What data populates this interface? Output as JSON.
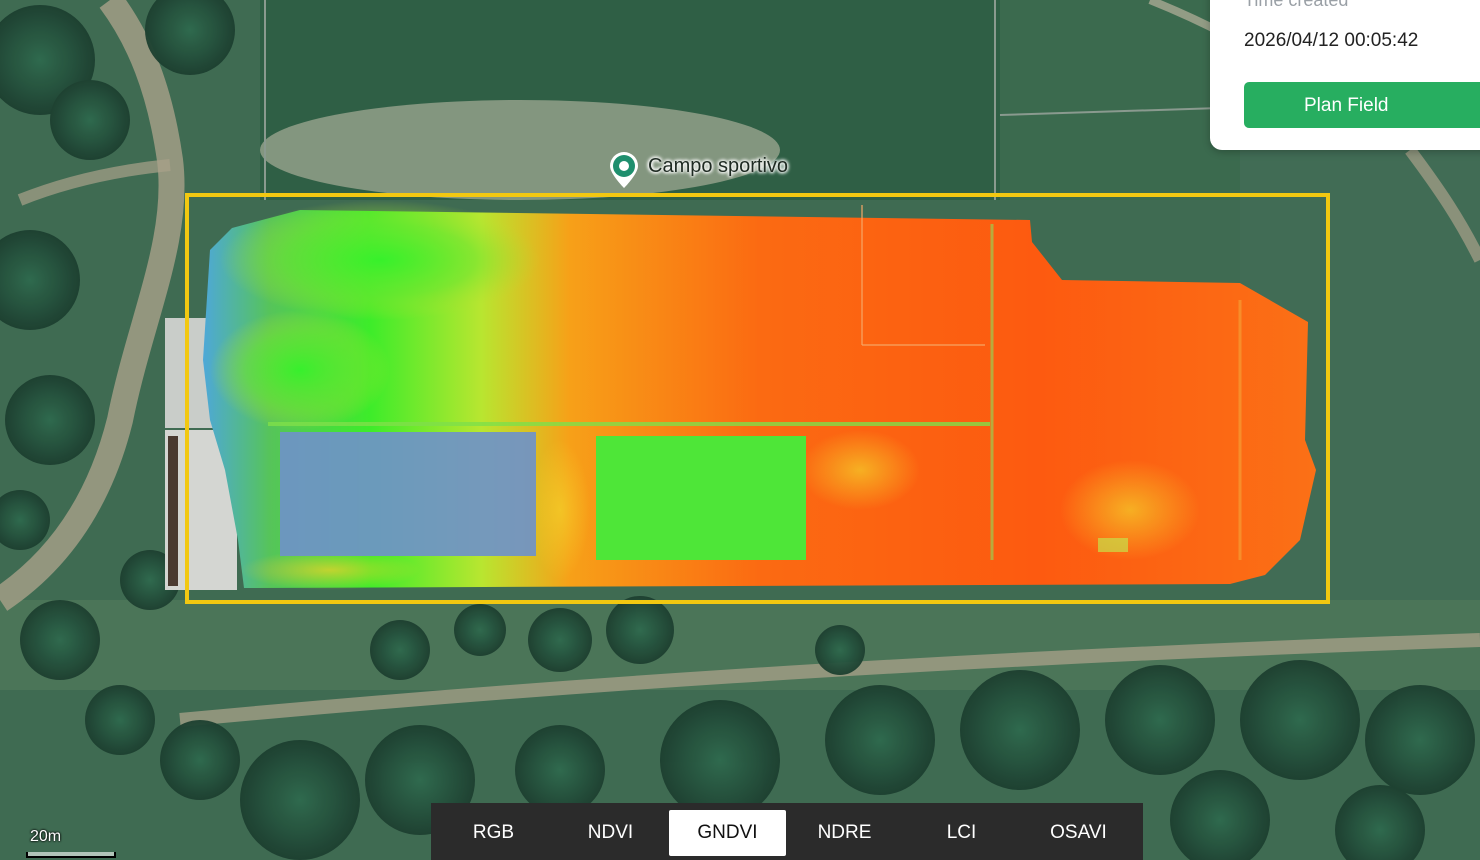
{
  "map": {
    "place_name": "Campo sportivo",
    "place_icon": "map-pin-icon",
    "boundary_color": "#f2c811",
    "scale_label": "20m"
  },
  "info_panel": {
    "time_label": "Time created",
    "time_value": "2026/04/12 00:05:42",
    "plan_button_label": "Plan Field",
    "button_color": "#27ae60"
  },
  "layers": {
    "tabs": [
      {
        "label": "RGB"
      },
      {
        "label": "NDVI"
      },
      {
        "label": "GNDVI"
      },
      {
        "label": "NDRE"
      },
      {
        "label": "LCI"
      },
      {
        "label": "OSAVI"
      }
    ],
    "active": "GNDVI"
  }
}
